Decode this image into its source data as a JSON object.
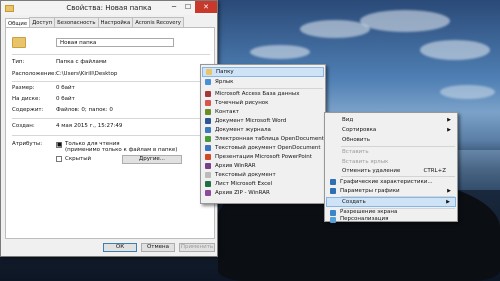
{
  "window": {
    "title": "Свойства: Новая папка",
    "tabs": [
      "Общие",
      "Доступ",
      "Безопасность",
      "Настройка",
      "Acronis Recovery"
    ],
    "folder_name": "Новая папка",
    "type_label": "Тип:",
    "type_value": "Папка с файлами",
    "location_label": "Расположение:",
    "location_value": "C:\\Users\\Kirill\\Desktop",
    "size_label": "Размер:",
    "size_value": "0 байт",
    "disk_label": "На диске:",
    "disk_value": "0 байт",
    "contains_label": "Содержит:",
    "contains_value": "Файлов: 0; папок: 0",
    "created_label": "Создан:",
    "created_value": "4 мая 2015 г., 15:27:49",
    "attributes_label": "Атрибуты:",
    "readonly_label": "Только для чтения",
    "readonly_sub": "(применимо только к файлам в папке)",
    "hidden_label": "Скрытый",
    "other_button": "Другие...",
    "ok": "ОК",
    "cancel": "Отмена",
    "apply": "Применить"
  },
  "new_submenu": [
    {
      "label": "Папку",
      "icon": "folder-icon",
      "color": "#e9c46a"
    },
    {
      "label": "Ярлык",
      "icon": "shortcut-icon",
      "color": "#4a90d9"
    },
    {
      "label": "Microsoft Access База данных",
      "icon": "access-icon",
      "color": "#a4373a"
    },
    {
      "label": "Точечный рисунок",
      "icon": "bitmap-icon",
      "color": "#d9534f"
    },
    {
      "label": "Контакт",
      "icon": "contact-icon",
      "color": "#6b8e23"
    },
    {
      "label": "Документ Microsoft Word",
      "icon": "word-icon",
      "color": "#2b5797"
    },
    {
      "label": "Документ журнала",
      "icon": "journal-icon",
      "color": "#3a7bbf"
    },
    {
      "label": "Электронная таблица OpenDocument",
      "icon": "ods-icon",
      "color": "#4a9a3a"
    },
    {
      "label": "Текстовый документ OpenDocument",
      "icon": "odt-icon",
      "color": "#3f74c2"
    },
    {
      "label": "Презентация Microsoft PowerPoint",
      "icon": "powerpoint-icon",
      "color": "#d24726"
    },
    {
      "label": "Архив WinRAR",
      "icon": "winrar-icon",
      "color": "#7a3d8c"
    },
    {
      "label": "Текстовый документ",
      "icon": "text-icon",
      "color": "#bbbbbb"
    },
    {
      "label": "Лист Microsoft Excel",
      "icon": "excel-icon",
      "color": "#1e7145"
    },
    {
      "label": "Архив ZIP - WinRAR",
      "icon": "zip-icon",
      "color": "#8a4b9c"
    }
  ],
  "context_menu": {
    "view": "Вид",
    "sort": "Сортировка",
    "refresh": "Обновить",
    "paste": "Вставить",
    "paste_shortcut": "Вставить ярлык",
    "undo": "Отменить удаление",
    "undo_key": "CTRL+Z",
    "graphics_props": "Графические характеристики...",
    "graphics_params": "Параметры графики",
    "create": "Создать",
    "resolution": "Разрешение экрана",
    "personalize": "Персонализация"
  }
}
